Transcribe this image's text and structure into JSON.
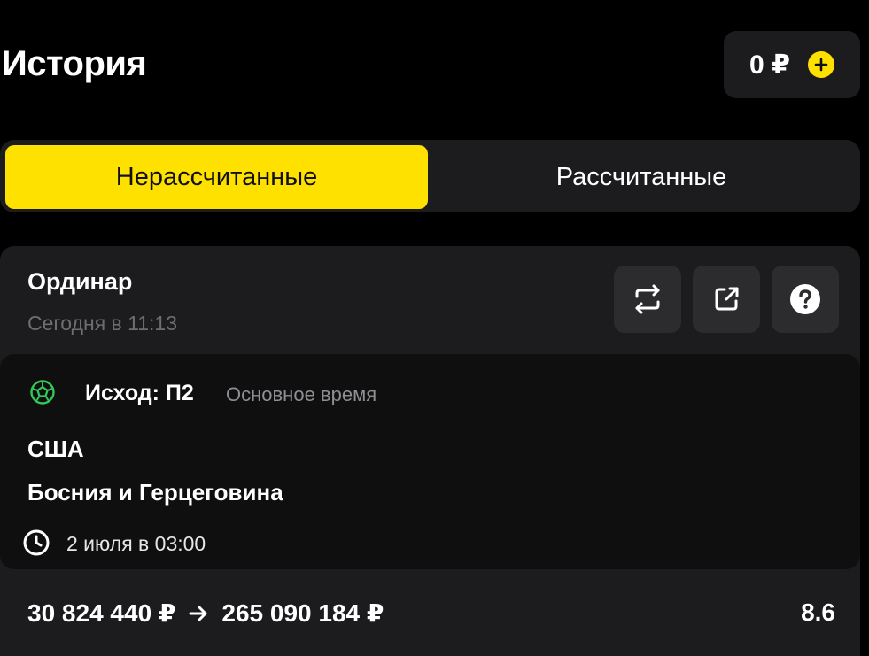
{
  "header": {
    "title": "История",
    "balance": "0 ₽",
    "add_funds_icon": "plus-circle-icon",
    "accent_color": "#ffe100"
  },
  "tabs": [
    {
      "label": "Нерассчитанные",
      "active": true
    },
    {
      "label": "Рассчитанные",
      "active": false
    }
  ],
  "bet": {
    "type": "Ординар",
    "date": "Сегодня в 11:13",
    "actions": [
      {
        "icon": "repeat-icon"
      },
      {
        "icon": "share-icon"
      },
      {
        "icon": "help-icon"
      }
    ],
    "event": {
      "sport_icon": "football-icon",
      "outcome": "Исход: П2",
      "period": "Основное время",
      "team_home": "США",
      "team_away": "Босния и Герцеговина",
      "time_icon": "clock-icon",
      "start_time": "2 июля в 03:00"
    },
    "stake": "30 824 440 ₽",
    "potential_win": "265 090 184 ₽",
    "coefficient": "8.6"
  }
}
